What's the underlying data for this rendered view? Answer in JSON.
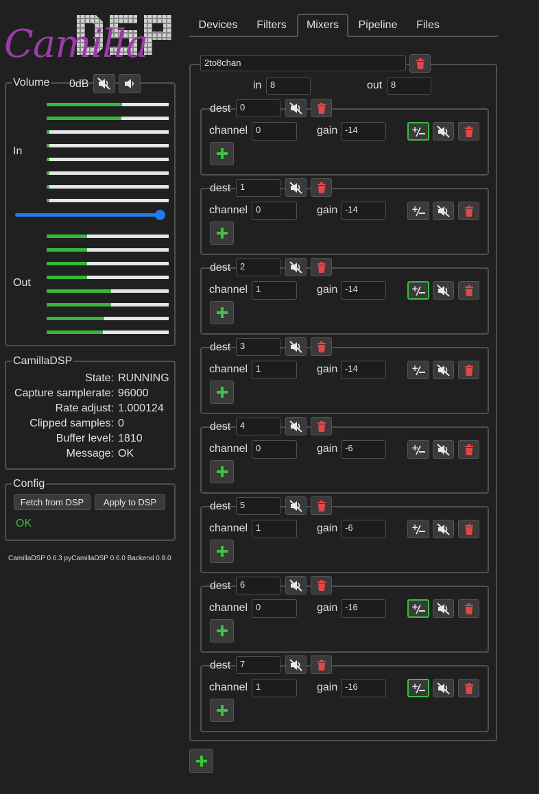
{
  "logo": {
    "camilla": "Camilla",
    "dsp": "DSP"
  },
  "volume": {
    "legend": "Volume",
    "db": "0dB",
    "in_label": "In",
    "out_label": "Out",
    "in_levels": [
      0.62,
      0.61,
      0.02,
      0.02,
      0.02,
      0.02,
      0.02,
      0.02
    ],
    "out_levels": [
      0.33,
      0.33,
      0.33,
      0.33,
      0.53,
      0.53,
      0.47,
      0.46
    ],
    "volume_level": 1.0
  },
  "status": {
    "legend": "CamillaDSP",
    "rows": [
      {
        "key": "State:",
        "value": "RUNNING"
      },
      {
        "key": "Capture samplerate:",
        "value": "96000"
      },
      {
        "key": "Rate adjust:",
        "value": "1.000124"
      },
      {
        "key": "Clipped samples:",
        "value": "0"
      },
      {
        "key": "Buffer level:",
        "value": "1810"
      },
      {
        "key": "Message:",
        "value": "OK"
      }
    ]
  },
  "config": {
    "legend": "Config",
    "fetch": "Fetch from DSP",
    "apply": "Apply to DSP",
    "result": "OK"
  },
  "footer": "CamillaDSP 0.6.3   pyCamillaDSP 0.6.0   Backend 0.8.0",
  "tabs": [
    "Devices",
    "Filters",
    "Mixers",
    "Pipeline",
    "Files"
  ],
  "active_tab": "Mixers",
  "mixer": {
    "name": "2to8chan",
    "in_label": "in",
    "out_label": "out",
    "in_value": "8",
    "out_value": "8",
    "dest_label": "dest",
    "channel_label": "channel",
    "gain_label": "gain",
    "destinations": [
      {
        "dest": "0",
        "channel": "0",
        "gain": "-14",
        "inverted": true
      },
      {
        "dest": "1",
        "channel": "0",
        "gain": "-14",
        "inverted": false
      },
      {
        "dest": "2",
        "channel": "1",
        "gain": "-14",
        "inverted": true
      },
      {
        "dest": "3",
        "channel": "1",
        "gain": "-14",
        "inverted": false
      },
      {
        "dest": "4",
        "channel": "0",
        "gain": "-6",
        "inverted": false
      },
      {
        "dest": "5",
        "channel": "1",
        "gain": "-6",
        "inverted": false
      },
      {
        "dest": "6",
        "channel": "0",
        "gain": "-16",
        "inverted": true
      },
      {
        "dest": "7",
        "channel": "1",
        "gain": "-16",
        "inverted": true
      }
    ]
  },
  "colors": {
    "accent_green": "#33c13a",
    "delete_red": "#e04848",
    "slider_blue": "#1e7bf0",
    "logo_purple": "#9a3ca6"
  }
}
